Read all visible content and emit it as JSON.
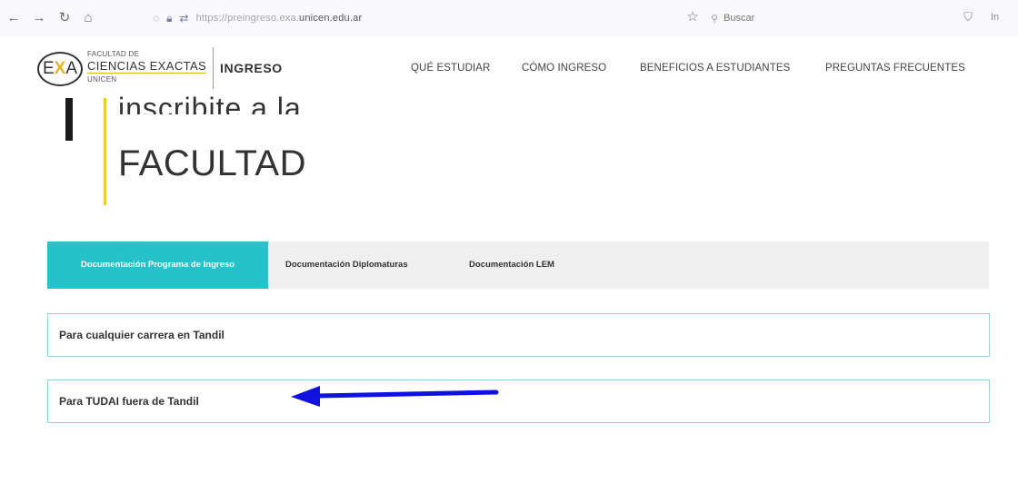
{
  "browser": {
    "back_icon": "arrow-right-icon",
    "reload_icon": "reload-icon",
    "home_icon": "home-icon",
    "url_prefix": "https://preingreso.exa.",
    "url_domain": "unicen.edu.ar",
    "search_placeholder": "Buscar",
    "extra_label": "In"
  },
  "header": {
    "logo_letters": {
      "left": "E",
      "mid": "X",
      "right": "A"
    },
    "logo_small": "FACULTAD DE",
    "logo_big": "CIENCIAS EXACTAS",
    "logo_unicen": "UNICEN",
    "section": "INGRESO",
    "nav": [
      {
        "label": "QUÉ ESTUDIAR"
      },
      {
        "label": "CÓMO INGRESO"
      },
      {
        "label": "BENEFICIOS A ESTUDIANTES"
      },
      {
        "label": "PREGUNTAS FRECUENTES"
      }
    ],
    "accent_color": "#e6b21f"
  },
  "hero": {
    "line1": "inscribite a la",
    "line2": "FACULTAD"
  },
  "tabs": [
    {
      "label": "Documentación Programa de Ingreso",
      "active": true
    },
    {
      "label": "Documentación Diplomaturas",
      "active": false
    },
    {
      "label": "Documentación LEM",
      "active": false
    }
  ],
  "accordion": [
    {
      "title": "Para cualquier carrera en Tandil"
    },
    {
      "title": "Para TUDAI fuera de Tandil"
    }
  ],
  "colors": {
    "tab_active": "#26c1c9",
    "accordion_border": "#8ed3d9",
    "annotation_arrow": "#1010e0"
  }
}
